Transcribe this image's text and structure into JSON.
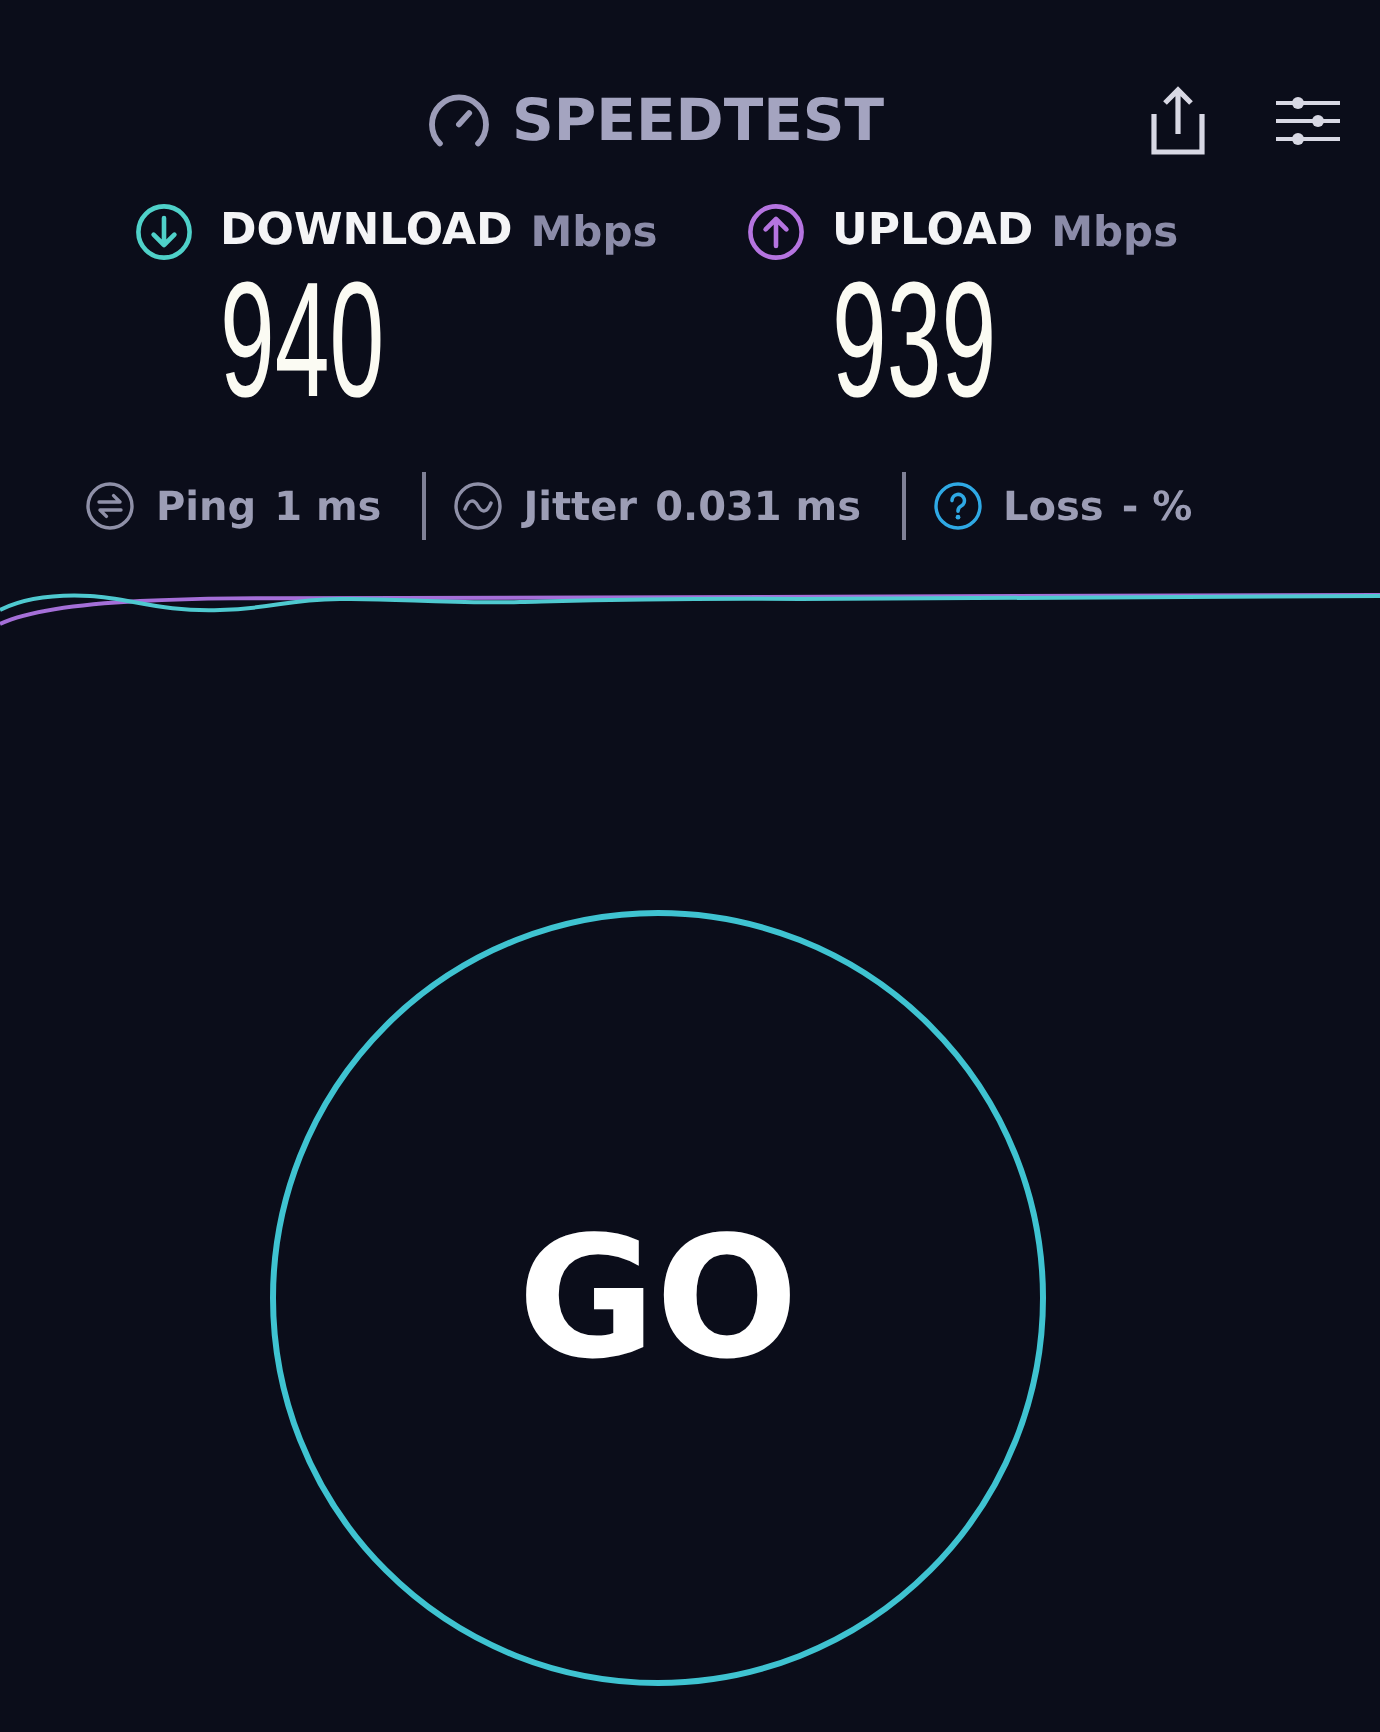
{
  "header": {
    "title": "SPEEDTEST"
  },
  "results": [
    {
      "kind": "download",
      "label": "DOWNLOAD",
      "unit": "Mbps",
      "value": "940",
      "color": "#4fd1c9"
    },
    {
      "kind": "upload",
      "label": "UPLOAD",
      "unit": "Mbps",
      "value": "939",
      "color": "#b574e0"
    }
  ],
  "metrics": [
    {
      "kind": "ping",
      "label": "Ping",
      "value": "1 ms"
    },
    {
      "kind": "jitter",
      "label": "Jitter",
      "value": "0.031 ms"
    },
    {
      "kind": "loss",
      "label": "Loss",
      "value": "- %"
    }
  ],
  "go_button": {
    "label": "GO"
  }
}
